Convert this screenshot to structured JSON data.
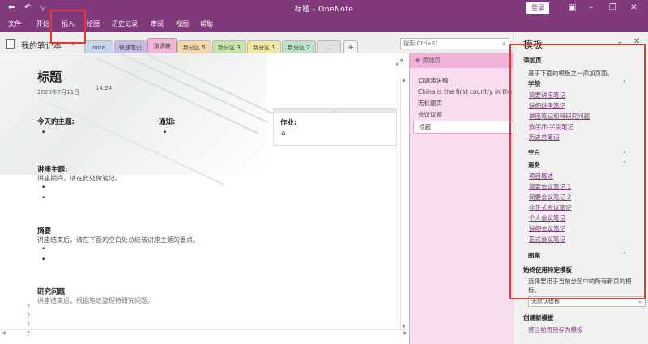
{
  "window": {
    "title": "标题 - OneNote",
    "login": "登录"
  },
  "titlebar_icons": {
    "back": "back-arrow-icon",
    "undo": "undo-icon",
    "pin": "pin-icon"
  },
  "menu": [
    "文件",
    "开始",
    "插入",
    "绘图",
    "历史记录",
    "审阅",
    "视图",
    "帮助"
  ],
  "notebook": {
    "name": "我的笔记本",
    "dropdown": "▾"
  },
  "tabs": [
    {
      "label": "note",
      "color": "#c5d5ee"
    },
    {
      "label": "快速笔记",
      "color": "#c9b8e6"
    },
    {
      "label": "演讲稿",
      "color": "#f4b6d8"
    },
    {
      "label": "新分区 5",
      "color": "#f7d7a8"
    },
    {
      "label": "新分区 3",
      "color": "#c6e3a8"
    },
    {
      "label": "新分区 1",
      "color": "#f2e9a0"
    },
    {
      "label": "新分区 2",
      "color": "#b9e2c8"
    },
    {
      "label": "...",
      "color": "#e2e2e2"
    },
    {
      "label": "+",
      "color": "#f5f5f5"
    }
  ],
  "search": {
    "placeholder": "搜索(Ctrl+E)"
  },
  "pages": {
    "add_label": "添加页",
    "items": [
      "口语演讲稿",
      "China is the first country in the",
      "无标题页",
      "会议议题",
      "标题"
    ],
    "selected": 4
  },
  "page": {
    "title": "标题",
    "date": "2020年7月11日",
    "time": "14:24",
    "today_topic": "今天的主题:",
    "notice": "通知:",
    "homework": "作业:",
    "lecture_topic": "讲座主题:",
    "lecture_text": "讲座期间，请在此处做笔记。",
    "summary": "摘要",
    "summary_text": "讲座结束后，请在下面的空白处总结该讲座主题的要点。",
    "research": "研究问题",
    "research_text": "讲座结束后，根据笔记整理待研究问题。",
    "bullet": "•",
    "question_mark": "?"
  },
  "template_panel": {
    "title": "模板",
    "add_page": "添加页",
    "add_page_desc": "基于下面的模板之一添加页面。",
    "sections": [
      {
        "name": "学院",
        "arrow": "^",
        "links": [
          "简要讲座笔记",
          "详细讲座笔记",
          "讲座笔记和待研究问题",
          "数学/科学类笔记",
          "历史类笔记"
        ]
      },
      {
        "name": "空白",
        "arrow": "v",
        "links": []
      },
      {
        "name": "商务",
        "arrow": "^",
        "links": [
          "项目概述",
          "简要会议笔记 1",
          "简要会议笔记 2",
          "非正式会议笔记",
          "个人会议笔记",
          "详细会议笔记",
          "正式会议笔记"
        ]
      },
      {
        "name": "图案",
        "arrow": "^",
        "links": []
      }
    ],
    "always_use": "始终使用特定模板",
    "always_use_desc_1": "选择要用于当前分区中的所有新页的模",
    "always_use_desc_2": "板。",
    "select_value": "无默认模板",
    "create_new": "创建新模板",
    "save_as": "将当前页另存为模板"
  }
}
